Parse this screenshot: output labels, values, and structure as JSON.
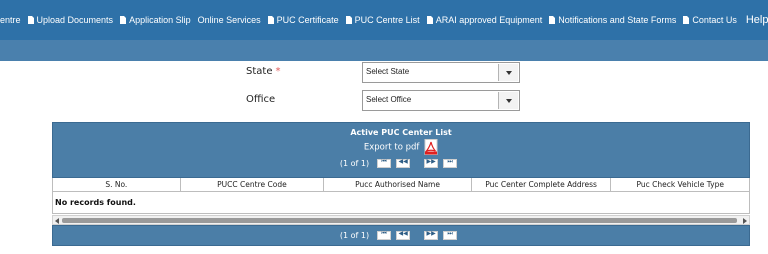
{
  "nav": {
    "items": [
      {
        "label": "entre",
        "icon": "doc-icon",
        "show_icon": false
      },
      {
        "label": "Upload Documents",
        "icon": "doc-icon",
        "show_icon": true
      },
      {
        "label": "Application Slip",
        "icon": "doc-icon",
        "show_icon": true
      },
      {
        "label": "Online Services",
        "icon": "",
        "show_icon": false
      },
      {
        "label": "PUC Certificate",
        "icon": "doc-icon",
        "show_icon": true
      },
      {
        "label": "PUC Centre List",
        "icon": "doc-icon",
        "show_icon": true
      },
      {
        "label": "ARAI approved Equipment",
        "icon": "doc-icon",
        "show_icon": true
      },
      {
        "label": "Notifications and State Forms",
        "icon": "doc-icon",
        "show_icon": true
      },
      {
        "label": "Contact Us",
        "icon": "doc-icon",
        "show_icon": true
      }
    ],
    "help_label": "Help",
    "bg_color": "#2e71a8",
    "subbar_color": "#4a80ad"
  },
  "form": {
    "state_label": "State",
    "required_mark": "*",
    "state_value": "Select State",
    "office_label": "Office",
    "office_value": "Select Office"
  },
  "table": {
    "title": "Active PUC Center List",
    "export_label": "Export to pdf",
    "export_icon": "pdf-icon",
    "page_report": "(1 of 1)",
    "pager_buttons": [
      "first-page-icon",
      "prev-page-icon",
      "next-page-icon",
      "last-page-icon"
    ],
    "columns": [
      "S. No.",
      "PUCC Centre Code",
      "Pucc Authorised Name",
      "Puc Center Complete Address",
      "Puc Check Vehicle Type"
    ],
    "empty_message": "No records found.",
    "header_color": "#4b7ea7"
  }
}
